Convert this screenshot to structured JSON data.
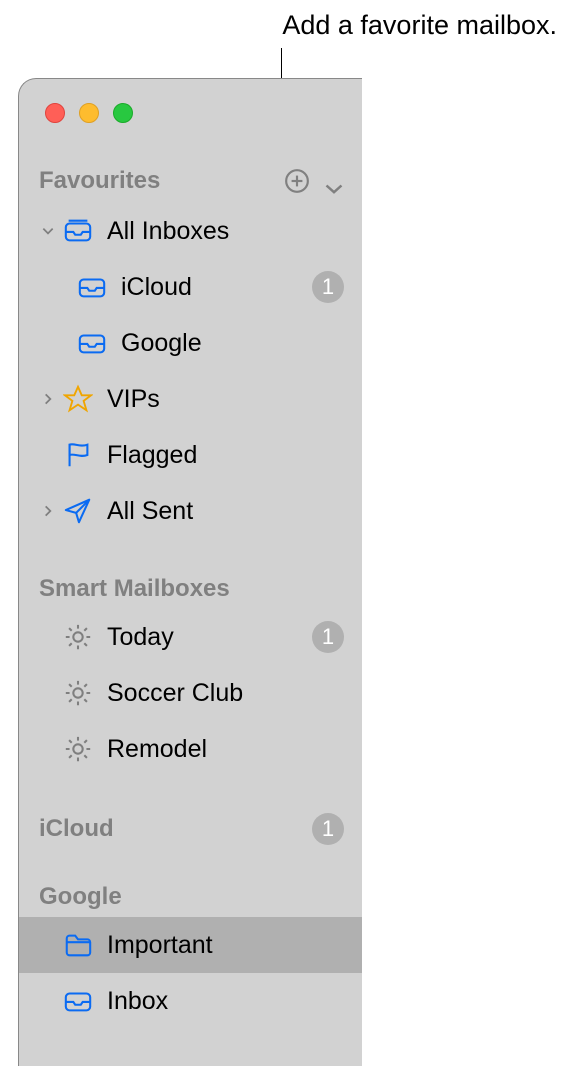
{
  "callout": "Add a favorite mailbox.",
  "sections": {
    "favourites": {
      "title": "Favourites",
      "items": {
        "allInboxes": {
          "label": "All Inboxes"
        },
        "iCloud": {
          "label": "iCloud",
          "badge": "1"
        },
        "google": {
          "label": "Google"
        },
        "vips": {
          "label": "VIPs"
        },
        "flagged": {
          "label": "Flagged"
        },
        "allSent": {
          "label": "All Sent"
        }
      }
    },
    "smartMailboxes": {
      "title": "Smart Mailboxes",
      "items": {
        "today": {
          "label": "Today",
          "badge": "1"
        },
        "soccer": {
          "label": "Soccer Club"
        },
        "remodel": {
          "label": "Remodel"
        }
      }
    },
    "iCloud": {
      "title": "iCloud",
      "badge": "1"
    },
    "googleAcct": {
      "title": "Google",
      "items": {
        "important": {
          "label": "Important"
        },
        "inbox": {
          "label": "Inbox"
        }
      }
    }
  }
}
